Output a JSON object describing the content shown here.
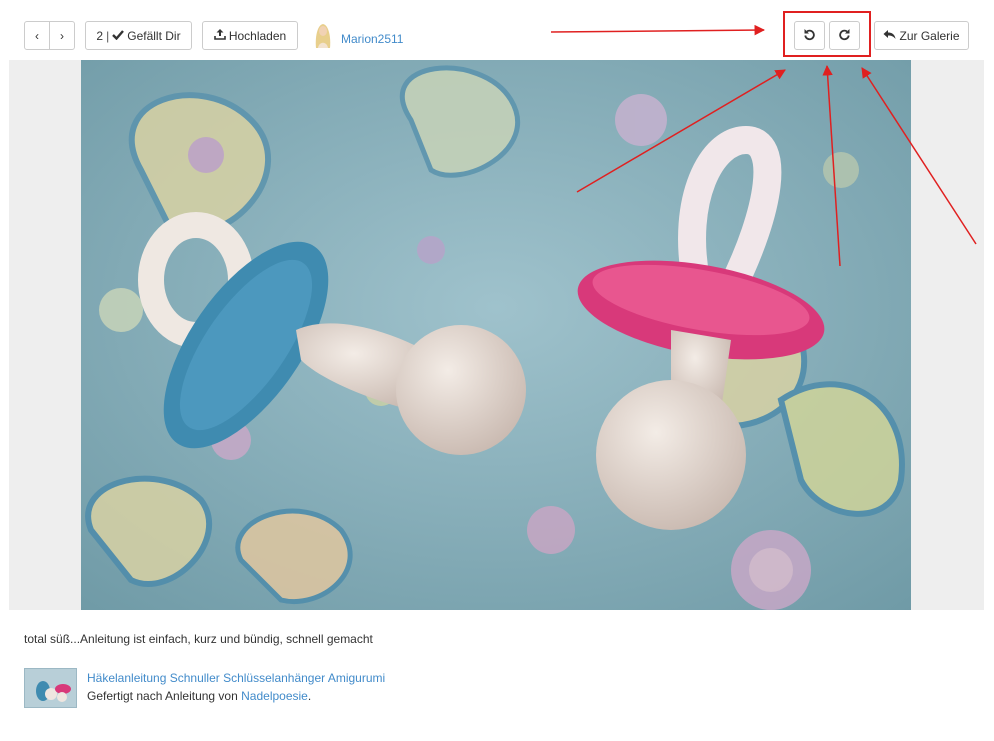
{
  "toolbar": {
    "prev_glyph": "‹",
    "next_glyph": "›",
    "like_count": "2",
    "like_separator": "|",
    "like_label": "Gefällt Dir",
    "upload_label": "Hochladen",
    "username": "Marion2511",
    "gallery_label": "Zur Galerie"
  },
  "icons": {
    "check": "check-icon",
    "upload": "upload-icon",
    "rotate_left": "rotate-left-icon",
    "rotate_right": "rotate-right-icon",
    "reply": "reply-icon"
  },
  "colors": {
    "link": "#428bca",
    "annotation": "#e02020",
    "stage_bg": "#eeeeee"
  },
  "comment": "total süß...Anleitung ist einfach, kurz und bündig, schnell gemacht",
  "pattern": {
    "title": "Häkelanleitung Schnuller Schlüsselanhänger Amigurumi",
    "made_after_prefix": "Gefertigt nach Anleitung von",
    "author": "Nadelpoesie",
    "suffix": "."
  }
}
